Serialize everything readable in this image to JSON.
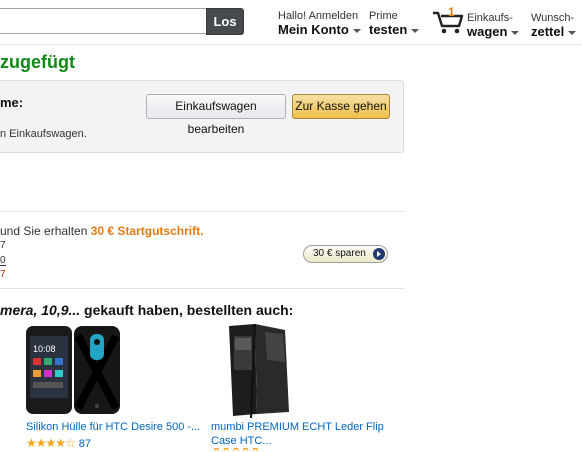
{
  "header": {
    "search_button": "Los",
    "account_line1": "Hallo! Anmelden",
    "account_line2": "Mein Konto",
    "prime_line1": "Prime",
    "prime_line2": "testen",
    "cart_count": "1",
    "cart_line1": "Einkaufs-",
    "cart_line2": "wagen",
    "wish_line1": "Wunsch-",
    "wish_line2": "zettel"
  },
  "main": {
    "added_title": "zugefügt",
    "cart_label": "me:",
    "cart_sub": "n Einkaufswagen.",
    "edit_button": "Einkaufswagen bearbeiten",
    "checkout_button": "Zur Kasse gehen"
  },
  "promo": {
    "text": "und Sie erhalten ",
    "credit": "30 € Startgutschrift.",
    "num1": "7",
    "num2": "0",
    "num3": "7",
    "save_button": "30 € sparen"
  },
  "recommendations": {
    "heading_italic": "mera, 10,9...",
    "heading_rest": " gekauft haben, bestellten auch:",
    "items": [
      {
        "title": "Silikon Hülle für HTC Desire 500 -...",
        "stars": "★★★★☆",
        "count": "87"
      },
      {
        "title_line1": "mumbi PREMIUM ECHT Leder Flip",
        "title_line2": "Case HTC..."
      }
    ]
  },
  "colors": {
    "success_green": "#0e8a16",
    "credit_orange": "#e47911",
    "link_blue": "#0066c0",
    "checkout_yellow": "#f0c14b"
  }
}
